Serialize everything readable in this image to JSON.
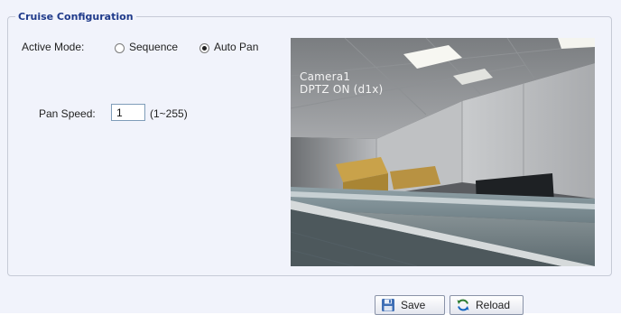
{
  "section": {
    "legend": "Cruise Configuration"
  },
  "active_mode": {
    "label": "Active Mode:",
    "options": [
      {
        "label": "Sequence",
        "selected": false
      },
      {
        "label": "Auto Pan",
        "selected": true
      }
    ]
  },
  "pan_speed": {
    "label": "Pan Speed:",
    "value": "1",
    "range": "(1~255)"
  },
  "camera": {
    "name": "Camera1",
    "status": "DPTZ ON (d1x)"
  },
  "buttons": {
    "save": {
      "label": "Save",
      "icon": "save-disk-icon"
    },
    "reload": {
      "label": "Reload",
      "icon": "reload-icon"
    }
  }
}
